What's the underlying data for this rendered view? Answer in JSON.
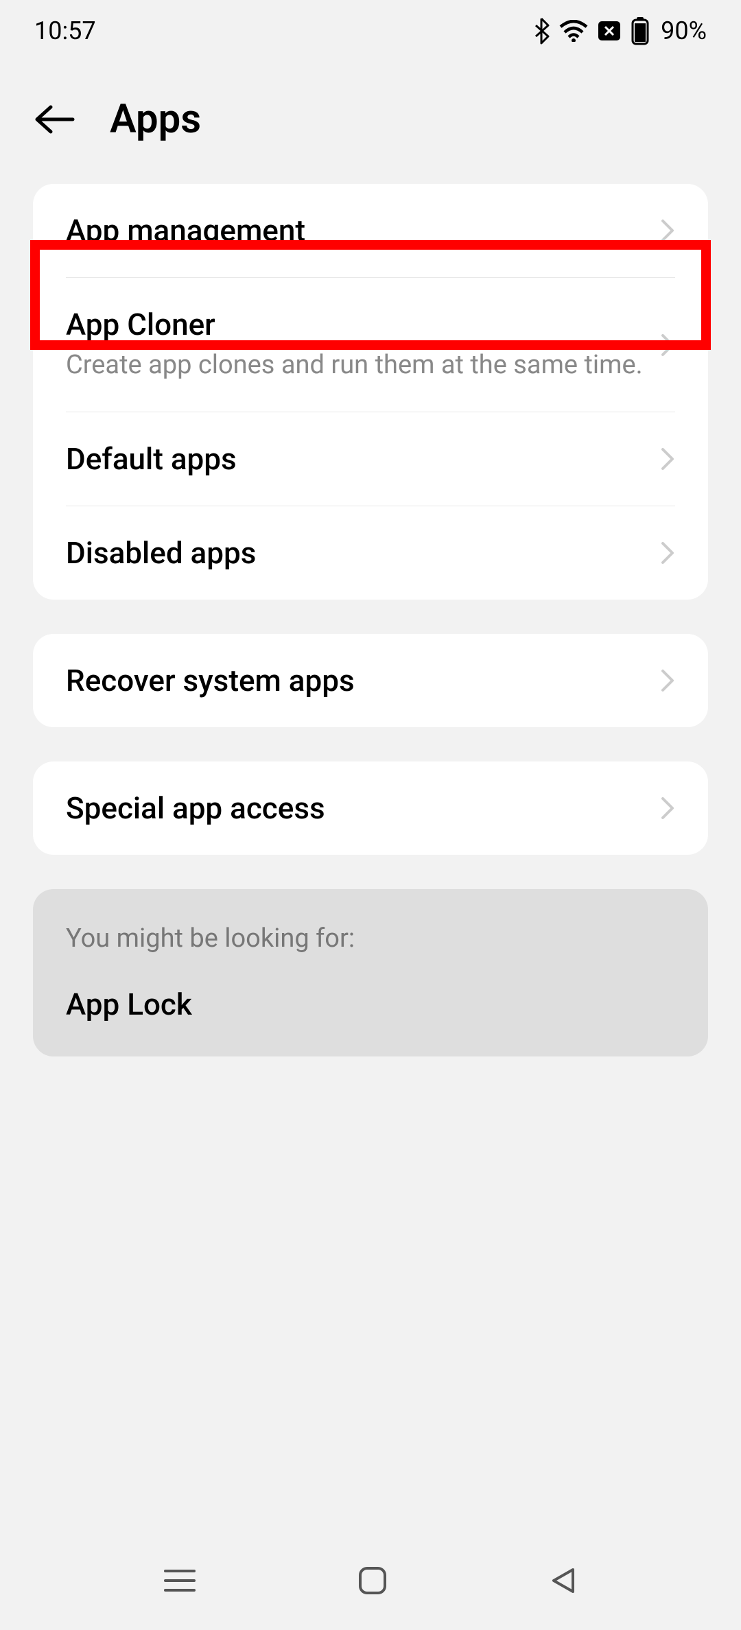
{
  "status": {
    "time": "10:57",
    "battery_pct": "90%"
  },
  "header": {
    "title": "Apps"
  },
  "sections": {
    "s1": [
      {
        "title": "App management",
        "sub": ""
      },
      {
        "title": "App Cloner",
        "sub": "Create app clones and run them at the same time."
      },
      {
        "title": "Default apps",
        "sub": ""
      },
      {
        "title": "Disabled apps",
        "sub": ""
      }
    ],
    "s2": [
      {
        "title": "Recover system apps",
        "sub": ""
      }
    ],
    "s3": [
      {
        "title": "Special app access",
        "sub": ""
      }
    ]
  },
  "suggest": {
    "head": "You might be looking for:",
    "item": "App Lock"
  }
}
